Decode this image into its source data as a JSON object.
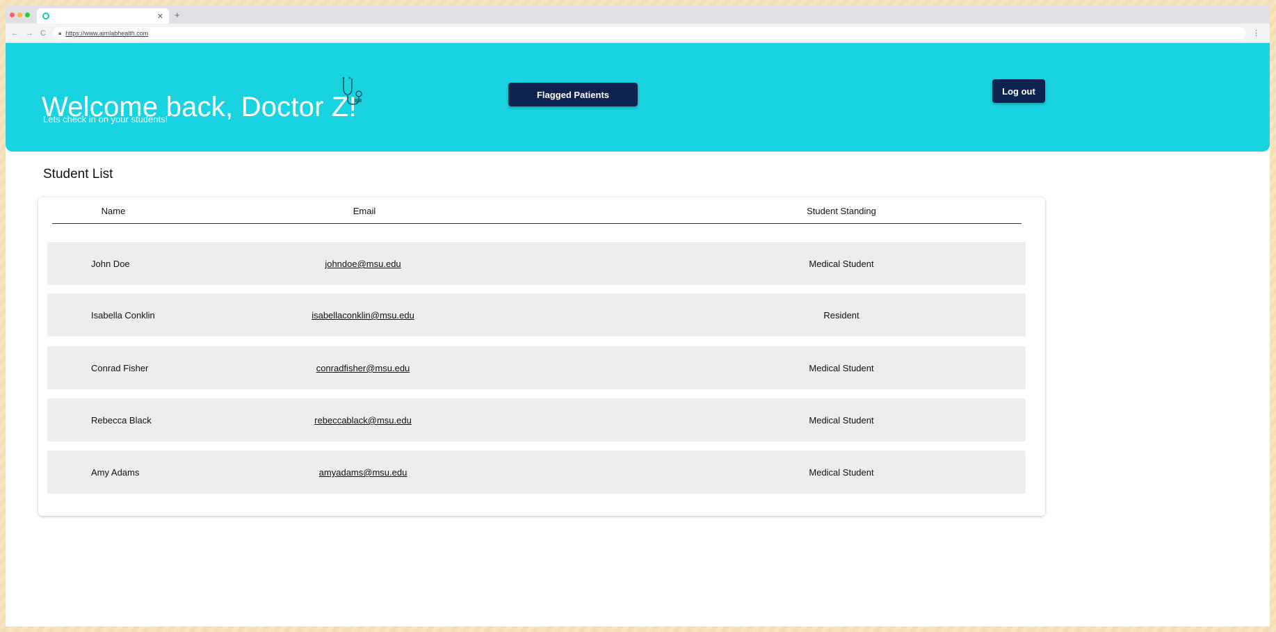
{
  "browser": {
    "url": "https://www.aimlabhealth.com"
  },
  "header": {
    "welcome": "Welcome back, Doctor Z!",
    "subtitle": "Lets check in on your students!",
    "flagged_button": "Flagged Patients",
    "logout_button": "Log out",
    "banner_color": "#1ad3e0",
    "button_color": "#0e2350"
  },
  "student_list": {
    "title": "Student List",
    "columns": [
      "Name",
      "Email",
      "Student Standing"
    ],
    "rows": [
      {
        "name": "John Doe",
        "email": "johndoe@msu.edu",
        "standing": "Medical Student"
      },
      {
        "name": "Isabella Conklin",
        "email": "isabellaconklin@msu.edu",
        "standing": "Resident"
      },
      {
        "name": "Conrad Fisher",
        "email": "conradfisher@msu.edu",
        "standing": "Medical Student"
      },
      {
        "name": "Rebecca Black",
        "email": "rebeccablack@msu.edu",
        "standing": "Medical Student"
      },
      {
        "name": "Amy Adams",
        "email": "amyadams@msu.edu",
        "standing": "Medical Student"
      }
    ]
  }
}
